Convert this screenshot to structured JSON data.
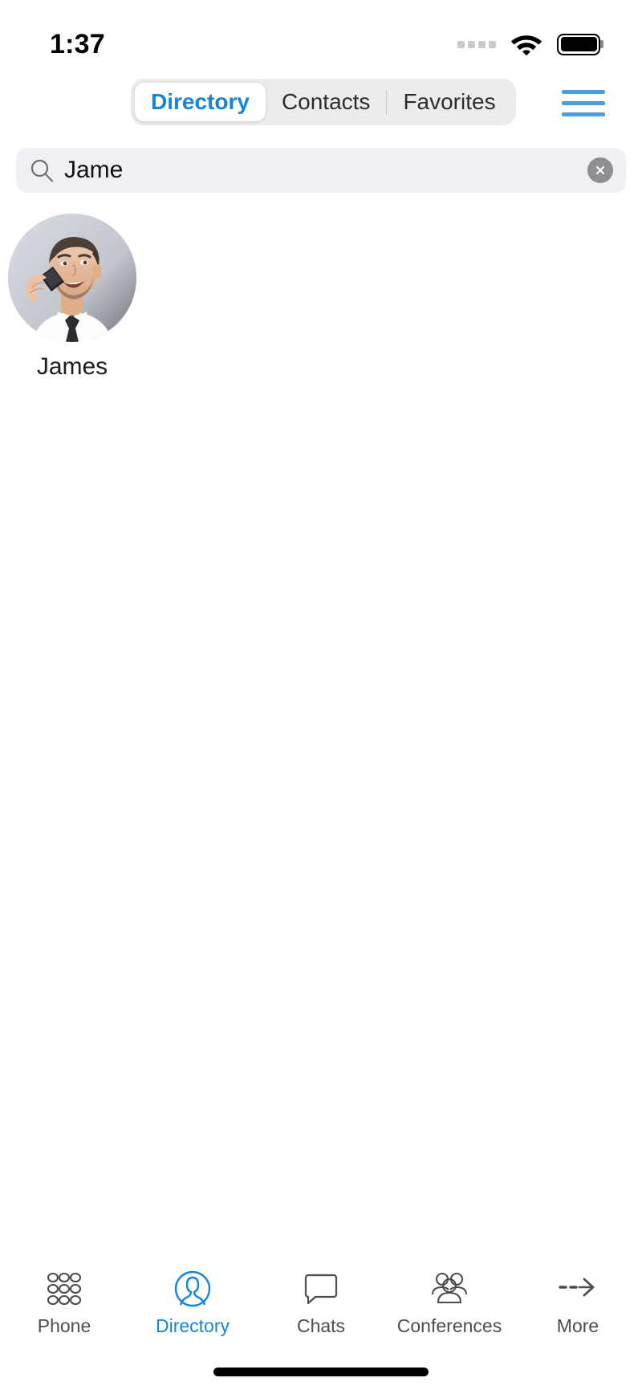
{
  "status_bar": {
    "time": "1:37",
    "signal_icon": "signal-dots-icon",
    "wifi_icon": "wifi-icon",
    "battery_icon": "battery-full-icon"
  },
  "nav": {
    "segments": [
      {
        "label": "Directory",
        "active": true
      },
      {
        "label": "Contacts",
        "active": false
      },
      {
        "label": "Favorites",
        "active": false
      }
    ],
    "menu_icon": "hamburger-menu-icon"
  },
  "search": {
    "icon": "search-icon",
    "value": "Jame",
    "placeholder": "Search",
    "clear_icon": "clear-circle-icon"
  },
  "results": [
    {
      "name": "James",
      "avatar": "photo-man-on-phone"
    }
  ],
  "tab_bar": [
    {
      "label": "Phone",
      "icon": "keypad-icon",
      "active": false
    },
    {
      "label": "Directory",
      "icon": "person-circle-icon",
      "active": true
    },
    {
      "label": "Chats",
      "icon": "speech-bubble-icon",
      "active": false
    },
    {
      "label": "Conferences",
      "icon": "people-group-icon",
      "active": false
    },
    {
      "label": "More",
      "icon": "dashed-arrow-right-icon",
      "active": false
    }
  ],
  "home_indicator": "home-indicator-bar",
  "colors": {
    "accent": "#1783d9",
    "hamburger": "#4a9ede",
    "search_bg": "#f0f0f4",
    "segmented_bg": "#ececee",
    "tab_inactive": "#4d4d4f",
    "clear_btn": "#8e8e93"
  }
}
